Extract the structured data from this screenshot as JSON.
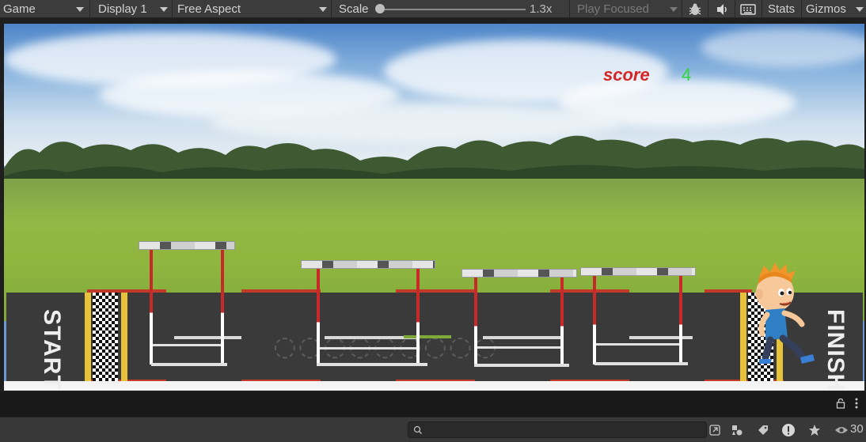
{
  "toolbar": {
    "game_tab": "Game",
    "display": "Display 1",
    "aspect": "Free Aspect",
    "scale_label": "Scale",
    "scale_value": "1.3x",
    "scale_fraction": 0.0,
    "play_focused": "Play Focused",
    "stats": "Stats",
    "gizmos": "Gizmos"
  },
  "game": {
    "score_label": "score",
    "score_value": "4",
    "start_text": "START",
    "finish_text": "FINISH",
    "colors": {
      "score_label": "#d52525",
      "score_value": "#2fd53b",
      "track": "#3a3a3a",
      "grass": "#8fb63f"
    }
  },
  "bottom": {
    "search_placeholder": "",
    "visibility_count": "30"
  },
  "icons": [
    "bug-icon",
    "audio-icon",
    "keyboard-icon",
    "lock-icon",
    "more-icon",
    "search-icon",
    "scene-link-icon",
    "hierarchy-icon",
    "tag-icon",
    "warning-icon",
    "star-icon",
    "eye-icon"
  ]
}
